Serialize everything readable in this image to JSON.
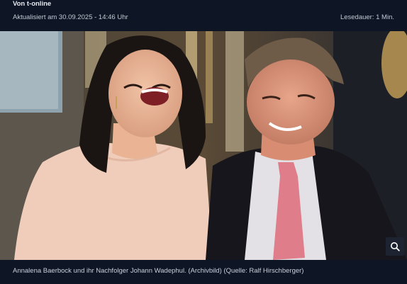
{
  "article": {
    "source": "Von t-online",
    "updated": "Aktualisiert am 30.09.2025 - 14:46 Uhr",
    "reading_time": "Lesedauer: 1 Min."
  },
  "image": {
    "caption": "Annalena Baerbock und ihr Nachfolger Johann Wadephul. (Archivbild) (Quelle: Ralf Hirschberger)",
    "zoom_icon": "magnifier-icon"
  },
  "colors": {
    "background": "#0e1626",
    "text": "#c9ced8"
  }
}
